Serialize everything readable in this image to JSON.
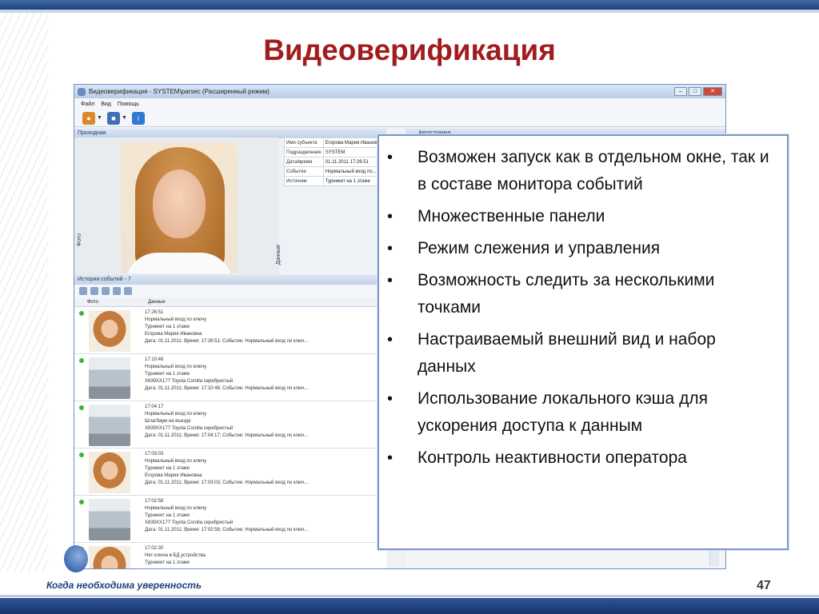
{
  "slide": {
    "title": "Видеоверификация",
    "slogan": "Когда необходима уверенность",
    "page_number": "47"
  },
  "window": {
    "title": "Видеоверификация - SYSTEM\\parsec (Расширенный режим)",
    "menu": [
      "Файл",
      "Вид",
      "Помощь"
    ],
    "controls": [
      "–",
      "□",
      "✕"
    ],
    "toolbar_icons": [
      "users-icon",
      "camera-icon",
      "info-icon"
    ],
    "panes": {
      "entry_head": "Проходная",
      "photo_label": "Фото",
      "data_label": "Данные",
      "right_head": "Автостоянка",
      "history_head": "История событий - 7"
    },
    "info": [
      {
        "k": "Имя субъекта",
        "v": "Егорова Мария Иванова"
      },
      {
        "k": "Подразделение",
        "v": "SYSTEM"
      },
      {
        "k": "Дата/время",
        "v": "01.11.2011 17:26:51"
      },
      {
        "k": "Событие",
        "v": "Нормальный вход по..."
      },
      {
        "k": "Источник",
        "v": "Турникет на 1 этаже"
      }
    ],
    "history_columns": [
      "Фото",
      "Данные"
    ],
    "history_rows": [
      {
        "thumb": "face",
        "time": "17:26:51",
        "l1": "Нормальный вход по ключу",
        "l2": "Турникет на 1 этаже",
        "l3": "Егорова Мария Ивановна",
        "l4": "Дата: 01.11.2011; Время: 17:26:51; Событие: Нормальный вход по ключ..."
      },
      {
        "thumb": "car",
        "time": "17:10:48",
        "l1": "Нормальный вход по ключу",
        "l2": "Турникет на 1 этаже",
        "l3": "Х839ХХ177 Toyota Corolla серебристый",
        "l4": "Дата: 01.11.2011; Время: 17:10:48; Событие: Нормальный вход по ключ..."
      },
      {
        "thumb": "car",
        "time": "17:04:17",
        "l1": "Нормальный вход по ключу",
        "l2": "Шлагбаум на въезде",
        "l3": "Х839ХХ177 Toyota Corolla серебристый",
        "l4": "Дата: 01.11.2011; Время: 17:04:17; Событие: Нормальный вход по ключ..."
      },
      {
        "thumb": "face",
        "time": "17:03:03",
        "l1": "Нормальный вход по ключу",
        "l2": "Турникет на 1 этаже",
        "l3": "Егорова Мария Ивановна",
        "l4": "Дата: 01.11.2011; Время: 17:03:03; Событие: Нормальный вход по ключ..."
      },
      {
        "thumb": "car",
        "time": "17:02:58",
        "l1": "Нормальный вход по ключу",
        "l2": "Турникет на 1 этаже",
        "l3": "Х839ХХ177 Toyota Corolla серебристый",
        "l4": "Дата: 01.11.2011; Время: 17:02:58; Событие: Нормальный вход по ключ..."
      },
      {
        "thumb": "face",
        "time": "17:02:30",
        "l1": "Нет ключа в БД устройства",
        "l2": "Турникет на 1 этаже",
        "l3": "",
        "l4": ""
      }
    ]
  },
  "features": [
    "Возможен запуск как в отдельном окне, так и в составе монитора событий",
    "Множественные панели",
    "Режим слежения и управления",
    "Возможность следить за несколькими точками",
    "Настраиваемый внешний вид и набор данных",
    "Использование локального кэша для ускорения доступа к данным",
    "Контроль неактивности оператора"
  ],
  "colors": {
    "title": "#a11d1d",
    "accent_blue": "#1d3f78",
    "callout_border": "#7a96c8"
  }
}
